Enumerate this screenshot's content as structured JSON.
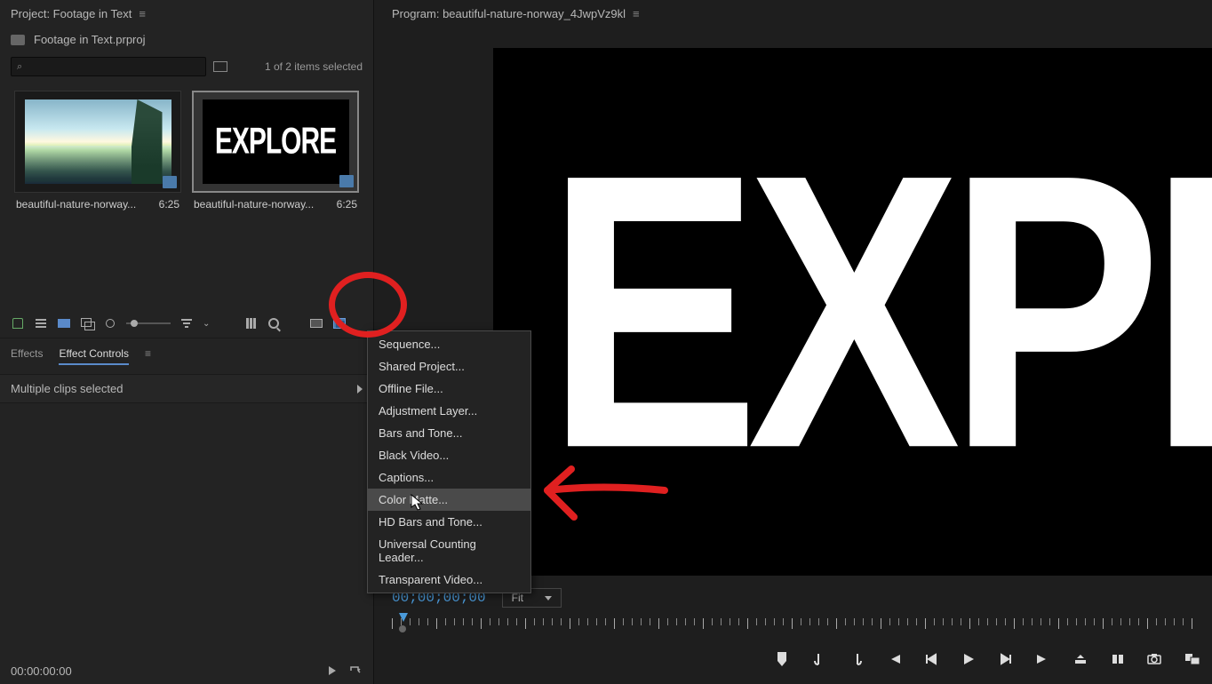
{
  "project": {
    "panel_title": "Project: Footage in Text",
    "file_name": "Footage in Text.prproj",
    "selection_status": "1 of 2 items selected",
    "clips": [
      {
        "name": "beautiful-nature-norway...",
        "duration": "6:25"
      },
      {
        "name": "beautiful-nature-norway...",
        "duration": "6:25"
      }
    ],
    "explore_text": "EXPLORE"
  },
  "effects": {
    "tab1": "Effects",
    "tab2": "Effect Controls",
    "multi_clips": "Multiple clips selected",
    "bottom_time": "00:00:00:00"
  },
  "program": {
    "header": "Program: beautiful-nature-norway_4JwpVz9kl",
    "monitor_text": "EXPLORE",
    "timecode": "00;00;00;00",
    "fit_label": "Fit"
  },
  "menu": {
    "items": [
      "Sequence...",
      "Shared Project...",
      "Offline File...",
      "Adjustment Layer...",
      "Bars and Tone...",
      "Black Video...",
      "Captions...",
      "Color Matte...",
      "HD Bars and Tone...",
      "Universal Counting Leader...",
      "Transparent Video..."
    ],
    "highlighted_index": 7
  }
}
